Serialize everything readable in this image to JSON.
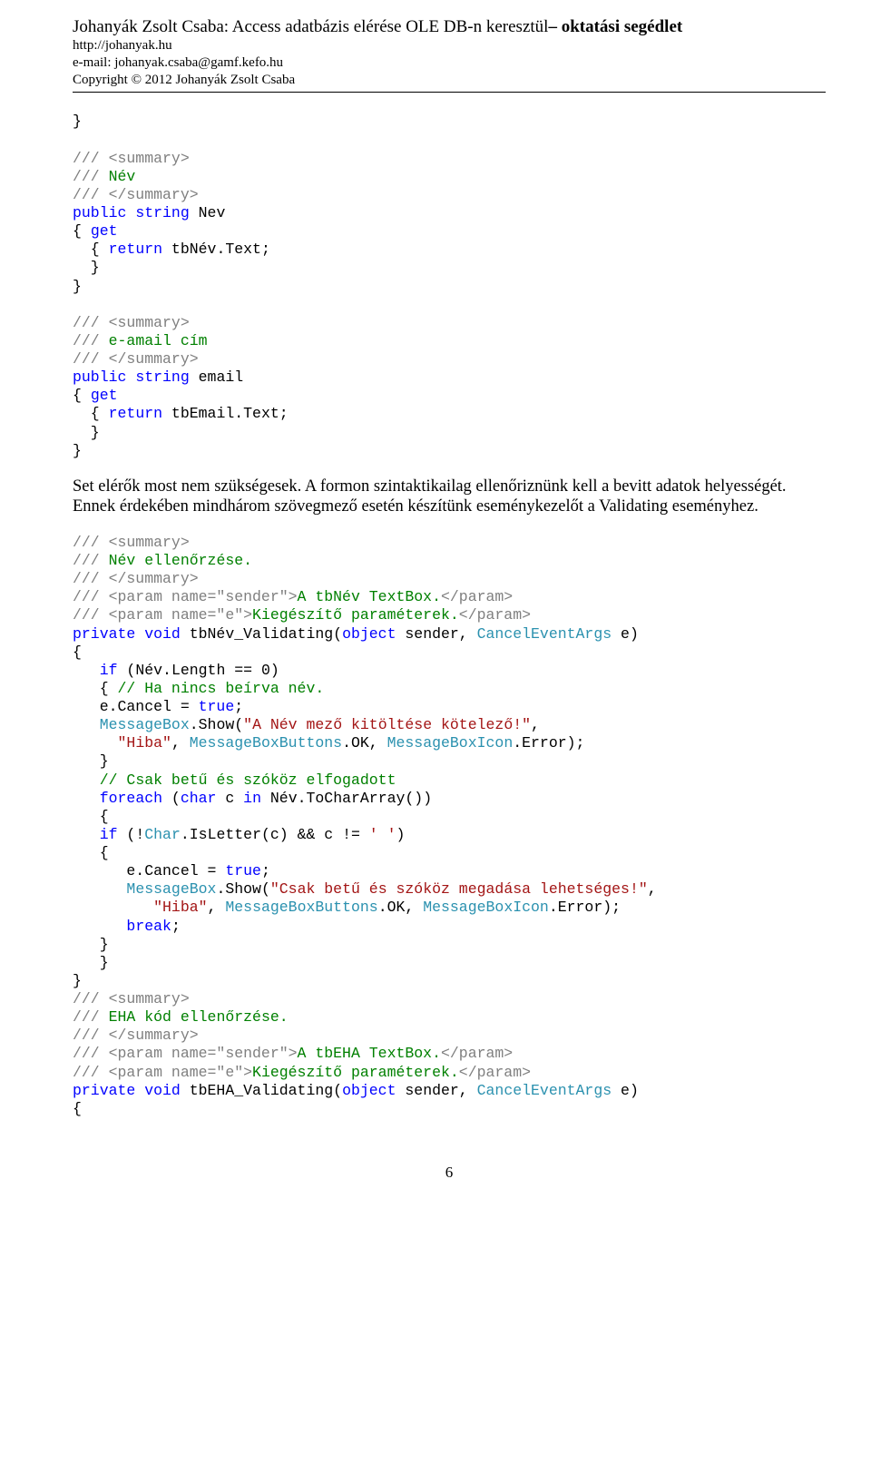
{
  "header": {
    "title1": "Johanyák Zsolt Csaba: Access adatbázis elérése OLE DB-n keresztül",
    "title2": "– oktatási segédlet",
    "site": "http://johanyak.hu",
    "email_label": "e-mail: johanyak.csaba@gamf.kefo.hu",
    "copyright": "Copyright © 2012 Johanyák Zsolt Csaba"
  },
  "para1": "Set elérők most nem szükségesek. A formon szintaktikailag ellenőriznünk kell a bevitt adatok helyességét. Ennek érdekében mindhárom szövegmező esetén készítünk eseménykezelőt a Validating eseményhez.",
  "pagenum": "6",
  "t": {
    "brace_close": "}",
    "brace_open": "{",
    "summary_open": "/// <summary>",
    "summary_close": "/// </summary>",
    "doc_nev": "/// Név",
    "pub_string_nev": "public string Nev",
    "get_open": "{ get",
    "ret_nev": "  { return tbNév.Text;",
    "close2": "  }",
    "doc_email": "/// e-amail cím",
    "pub_string_email": "public string email",
    "ret_email": "  { return tbEmail.Text;",
    "doc_nev_ell": "/// Név ellenőrzése.",
    "param_s_nev": "/// <param name=\"sender\">A tbNév TextBox.</param>",
    "param_e": "/// <param name=\"e\">Kiegészítő paraméterek.</param>",
    "sig_nev": "private void tbNév_Validating(object sender, CancelEventArgs e)",
    "if_nev": "   if (Név.Length == 0)",
    "comment_haninc": "   { // Ha nincs beírva név.",
    "cancel_true": "   e.Cancel = true;",
    "msg_show1a": "   MessageBox.Show(\"A Név mező kitöltése kötelező!\",",
    "msg_show1b": "     \"Hiba\", MessageBoxButtons.OK, MessageBoxIcon.Error);",
    "close3": "   }",
    "comment_only": "   // Csak betű és szóköz elfogadott",
    "foreach": "   foreach (char c in Név.ToCharArray())",
    "open3": "   {",
    "if_char": "   if (!Char.IsLetter(c) && c != ' ')",
    "cancel_true2": "      e.Cancel = true;",
    "msg_show2a": "      MessageBox.Show(\"Csak betű és szóköz megadása lehetséges!\",",
    "msg_show2b": "         \"Hiba\", MessageBoxButtons.OK, MessageBoxIcon.Error);",
    "break": "      break;",
    "doc_eha": "/// EHA kód ellenőrzése.",
    "param_s_eha": "/// <param name=\"sender\">A tbEHA TextBox.</param>",
    "sig_eha": "private void tbEHA_Validating(object sender, CancelEventArgs e)",
    "open1": "{",
    "open_ind3": "   {"
  }
}
